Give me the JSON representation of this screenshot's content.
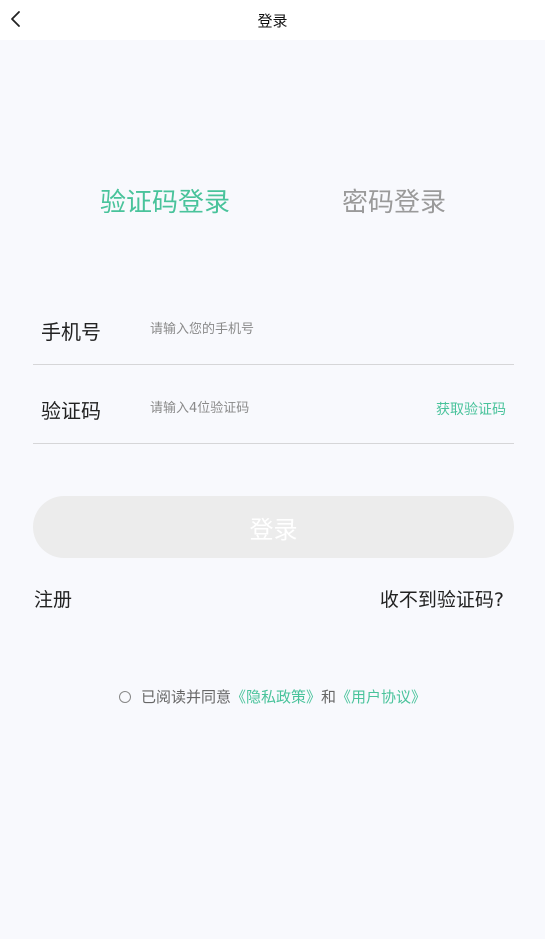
{
  "nav": {
    "title": "登录"
  },
  "tabs": {
    "sms_login": "验证码登录",
    "password_login": "密码登录"
  },
  "phone": {
    "label": "手机号",
    "placeholder": "请输入您的手机号",
    "value": ""
  },
  "code": {
    "label": "验证码",
    "placeholder": "请输入4位验证码",
    "value": "",
    "get_code": "获取验证码"
  },
  "login_button": "登录",
  "links": {
    "register": "注册",
    "no_code": "收不到验证码?"
  },
  "agreement": {
    "prefix": "已阅读并同意",
    "privacy": "《隐私政策》",
    "and": "和",
    "terms": "《用户协议》"
  },
  "colors": {
    "accent": "#49c39b",
    "inactive_tab": "#9a9a9a",
    "button_disabled": "#ececec",
    "background": "#f8f9fd"
  },
  "icons": {
    "back": "chevron-left-icon",
    "agree_toggle": "radio-circle-icon"
  }
}
